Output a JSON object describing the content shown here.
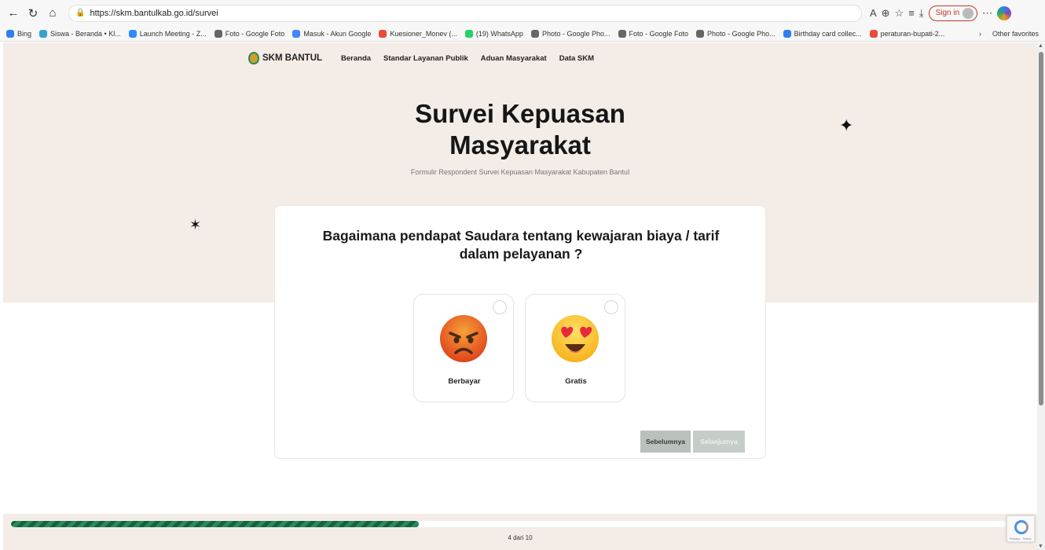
{
  "browser": {
    "url": "https://skm.bantulkab.go.id/survei",
    "sign_in": "Sign in",
    "bookmarks": [
      {
        "label": "Bing",
        "color": "#2f80ed"
      },
      {
        "label": "Siswa - Beranda • Kl...",
        "color": "#3aa0d0"
      },
      {
        "label": "Launch Meeting - Z...",
        "color": "#2d8cff"
      },
      {
        "label": "Foto - Google Foto",
        "color": "#666666"
      },
      {
        "label": "Masuk - Akun Google",
        "color": "#4285f4"
      },
      {
        "label": "Kuesioner_Monev (...",
        "color": "#e74c3c"
      },
      {
        "label": "(19) WhatsApp",
        "color": "#25d366"
      },
      {
        "label": "Photo - Google Pho...",
        "color": "#666666"
      },
      {
        "label": "Foto - Google Foto",
        "color": "#666666"
      },
      {
        "label": "Photo - Google Pho...",
        "color": "#666666"
      },
      {
        "label": "Birthday card collec...",
        "color": "#2f80ed"
      },
      {
        "label": "peraturan-bupati-2...",
        "color": "#e74c3c"
      }
    ],
    "other_favorites": "Other favorites"
  },
  "nav": {
    "logo": "SKM BANTUL",
    "links": [
      "Beranda",
      "Standar Layanan Publik",
      "Aduan Masyarakat",
      "Data SKM"
    ]
  },
  "hero": {
    "title_line1": "Survei Kepuasan",
    "title_line2": "Masyarakat",
    "subtitle": "Formulir Respondent Survei Kepuasan Masyarakat Kabupaten Bantul"
  },
  "question": {
    "text_line1": "Bagaimana pendapat Saudara tentang kewajaran biaya / tarif",
    "text_line2": "dalam pelayanan ?",
    "options": [
      {
        "label": "Berbayar",
        "icon": "angry-face-icon"
      },
      {
        "label": "Gratis",
        "icon": "heart-eyes-face-icon"
      }
    ],
    "prev_label": "Sebelumnya",
    "next_label": "Selanjutnya"
  },
  "progress": {
    "current": 4,
    "total": 10,
    "text": "4 dari 10",
    "fraction": 0.41
  },
  "colors": {
    "hero_bg": "#f3ece7",
    "progress": "#16613f"
  }
}
